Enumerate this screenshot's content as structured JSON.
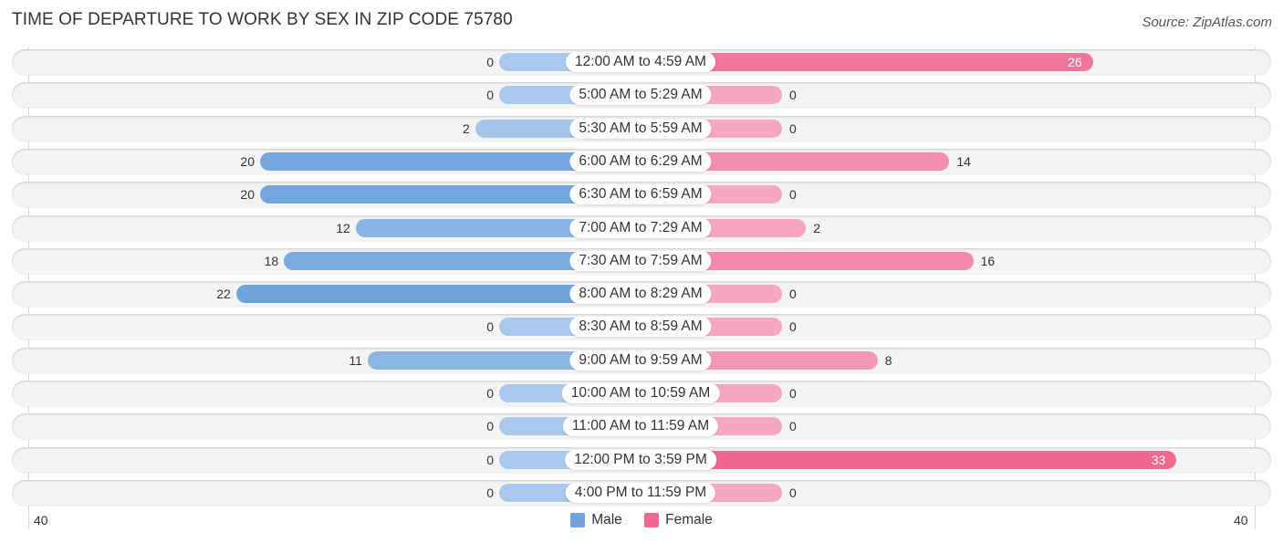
{
  "title": "TIME OF DEPARTURE TO WORK BY SEX IN ZIP CODE 75780",
  "source": "Source: ZipAtlas.com",
  "colors": {
    "male": "#6fa3dd",
    "male_light": "#a9c8eb",
    "female": "#f27fa4",
    "female_light": "#f6a8c2",
    "female_strong": "#f06892"
  },
  "legend": [
    {
      "label": "Male",
      "color": "#6fa3dd"
    },
    {
      "label": "Female",
      "color": "#f06892"
    }
  ],
  "axis": {
    "left_tick": "40",
    "right_tick": "40"
  },
  "chart_data": {
    "type": "bar",
    "orientation": "horizontal-diverging",
    "title": "TIME OF DEPARTURE TO WORK BY SEX IN ZIP CODE 75780",
    "xlabel": "",
    "ylabel": "",
    "xlim": [
      -40,
      40
    ],
    "legend_position": "bottom",
    "categories": [
      "12:00 AM to 4:59 AM",
      "5:00 AM to 5:29 AM",
      "5:30 AM to 5:59 AM",
      "6:00 AM to 6:29 AM",
      "6:30 AM to 6:59 AM",
      "7:00 AM to 7:29 AM",
      "7:30 AM to 7:59 AM",
      "8:00 AM to 8:29 AM",
      "8:30 AM to 8:59 AM",
      "9:00 AM to 9:59 AM",
      "10:00 AM to 10:59 AM",
      "11:00 AM to 11:59 AM",
      "12:00 PM to 3:59 PM",
      "4:00 PM to 11:59 PM"
    ],
    "series": [
      {
        "name": "Male",
        "values": [
          0,
          0,
          2,
          20,
          20,
          12,
          18,
          22,
          0,
          11,
          0,
          0,
          0,
          0
        ]
      },
      {
        "name": "Female",
        "values": [
          26,
          0,
          0,
          14,
          0,
          2,
          16,
          0,
          0,
          8,
          0,
          0,
          33,
          0
        ]
      }
    ]
  }
}
